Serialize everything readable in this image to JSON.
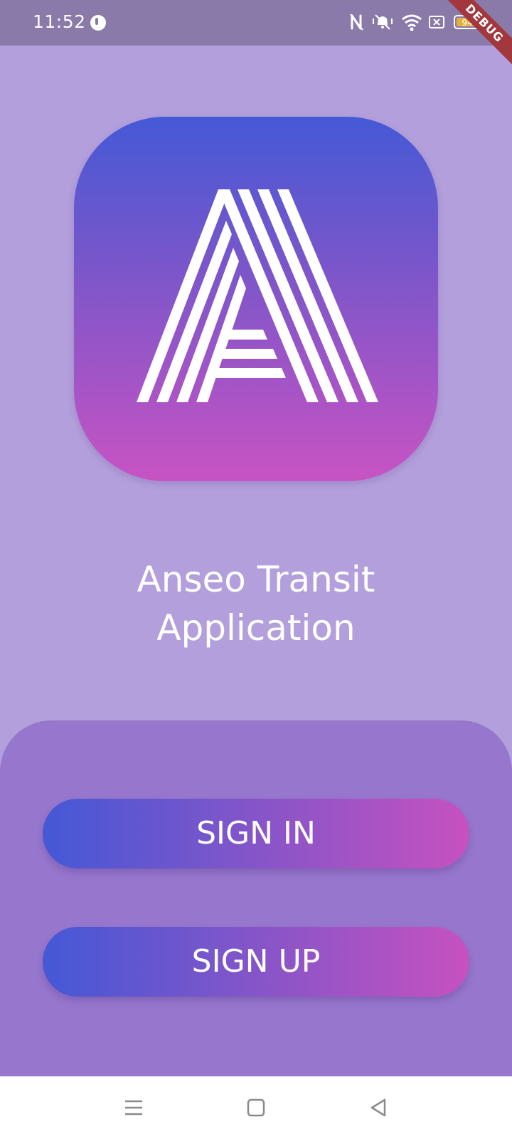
{
  "status_bar": {
    "time": "11:52",
    "battery_level": "94",
    "icons": [
      "app-notification-icon",
      "nfc-icon",
      "vibrate-icon",
      "wifi-icon",
      "no-sim-icon",
      "battery-icon"
    ]
  },
  "debug_banner": {
    "label": "DEBUG"
  },
  "logo": {
    "icon": "anseo-a-logo-icon",
    "gradient_top": "#4559d6",
    "gradient_bottom": "#c853c3"
  },
  "app_title": {
    "line1": "Anseo Transit",
    "line2": "Application"
  },
  "buttons": {
    "sign_in": "SIGN IN",
    "sign_up": "SIGN UP"
  },
  "colors": {
    "background": "#b29fdb",
    "panel": "#9677cd",
    "button_start": "#4458d6",
    "button_end": "#c751c0",
    "status_bar": "#8a7aa9"
  },
  "nav_bar": {
    "icons": [
      "menu-icon",
      "home-icon",
      "back-icon"
    ]
  }
}
